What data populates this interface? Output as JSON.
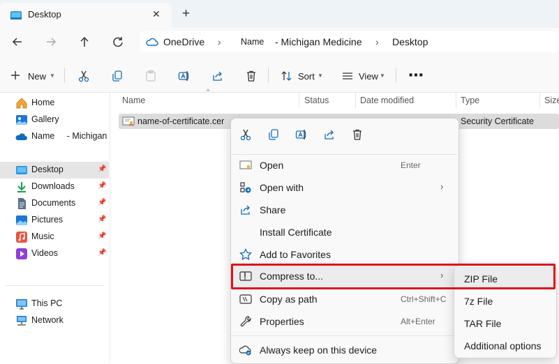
{
  "tab": {
    "title": "Desktop",
    "close": "✕",
    "new_tab": "+"
  },
  "address": {
    "crumbs": [
      "OneDrive",
      "Name",
      "- Michigan Medicine",
      "Desktop"
    ],
    "sep": "›"
  },
  "toolbar": {
    "new_label": "New",
    "sort_label": "Sort",
    "view_label": "View",
    "more": "⋯"
  },
  "nav": {
    "quick": [
      {
        "label": "Home",
        "icon": "home-icon"
      },
      {
        "label": "Gallery",
        "icon": "gallery-icon"
      },
      {
        "label": "Name     - Michigan",
        "icon": "onedrive-icon"
      }
    ],
    "pinned": [
      {
        "label": "Desktop",
        "icon": "desktop-icon"
      },
      {
        "label": "Downloads",
        "icon": "downloads-icon"
      },
      {
        "label": "Documents",
        "icon": "documents-icon"
      },
      {
        "label": "Pictures",
        "icon": "pictures-icon"
      },
      {
        "label": "Music",
        "icon": "music-icon"
      },
      {
        "label": "Videos",
        "icon": "videos-icon"
      }
    ],
    "devices": [
      {
        "label": "This PC",
        "icon": "pc-icon"
      },
      {
        "label": "Network",
        "icon": "network-icon"
      }
    ]
  },
  "columns": {
    "name": "Name",
    "status": "Status",
    "date": "Date modified",
    "type": "Type",
    "size": "Size"
  },
  "file": {
    "name": "name-of-certificate.cer",
    "type": "Security Certificate"
  },
  "context_menu": {
    "items": [
      {
        "label": "Open",
        "shortcut": "Enter"
      },
      {
        "label": "Open with",
        "shortcut": ""
      },
      {
        "label": "Share",
        "shortcut": ""
      },
      {
        "label": "Install Certificate",
        "shortcut": ""
      },
      {
        "label": "Add to Favorites",
        "shortcut": ""
      },
      {
        "label": "Compress to...",
        "shortcut": ""
      },
      {
        "label": "Copy as path",
        "shortcut": "Ctrl+Shift+C"
      },
      {
        "label": "Properties",
        "shortcut": "Alt+Enter"
      },
      {
        "label": "Always keep on this device",
        "shortcut": ""
      }
    ]
  },
  "submenu": {
    "items": [
      "ZIP File",
      "7z File",
      "TAR File",
      "Additional options"
    ]
  },
  "colors": {
    "accent": "#0f6cbd",
    "highlight": "#e0101a"
  }
}
